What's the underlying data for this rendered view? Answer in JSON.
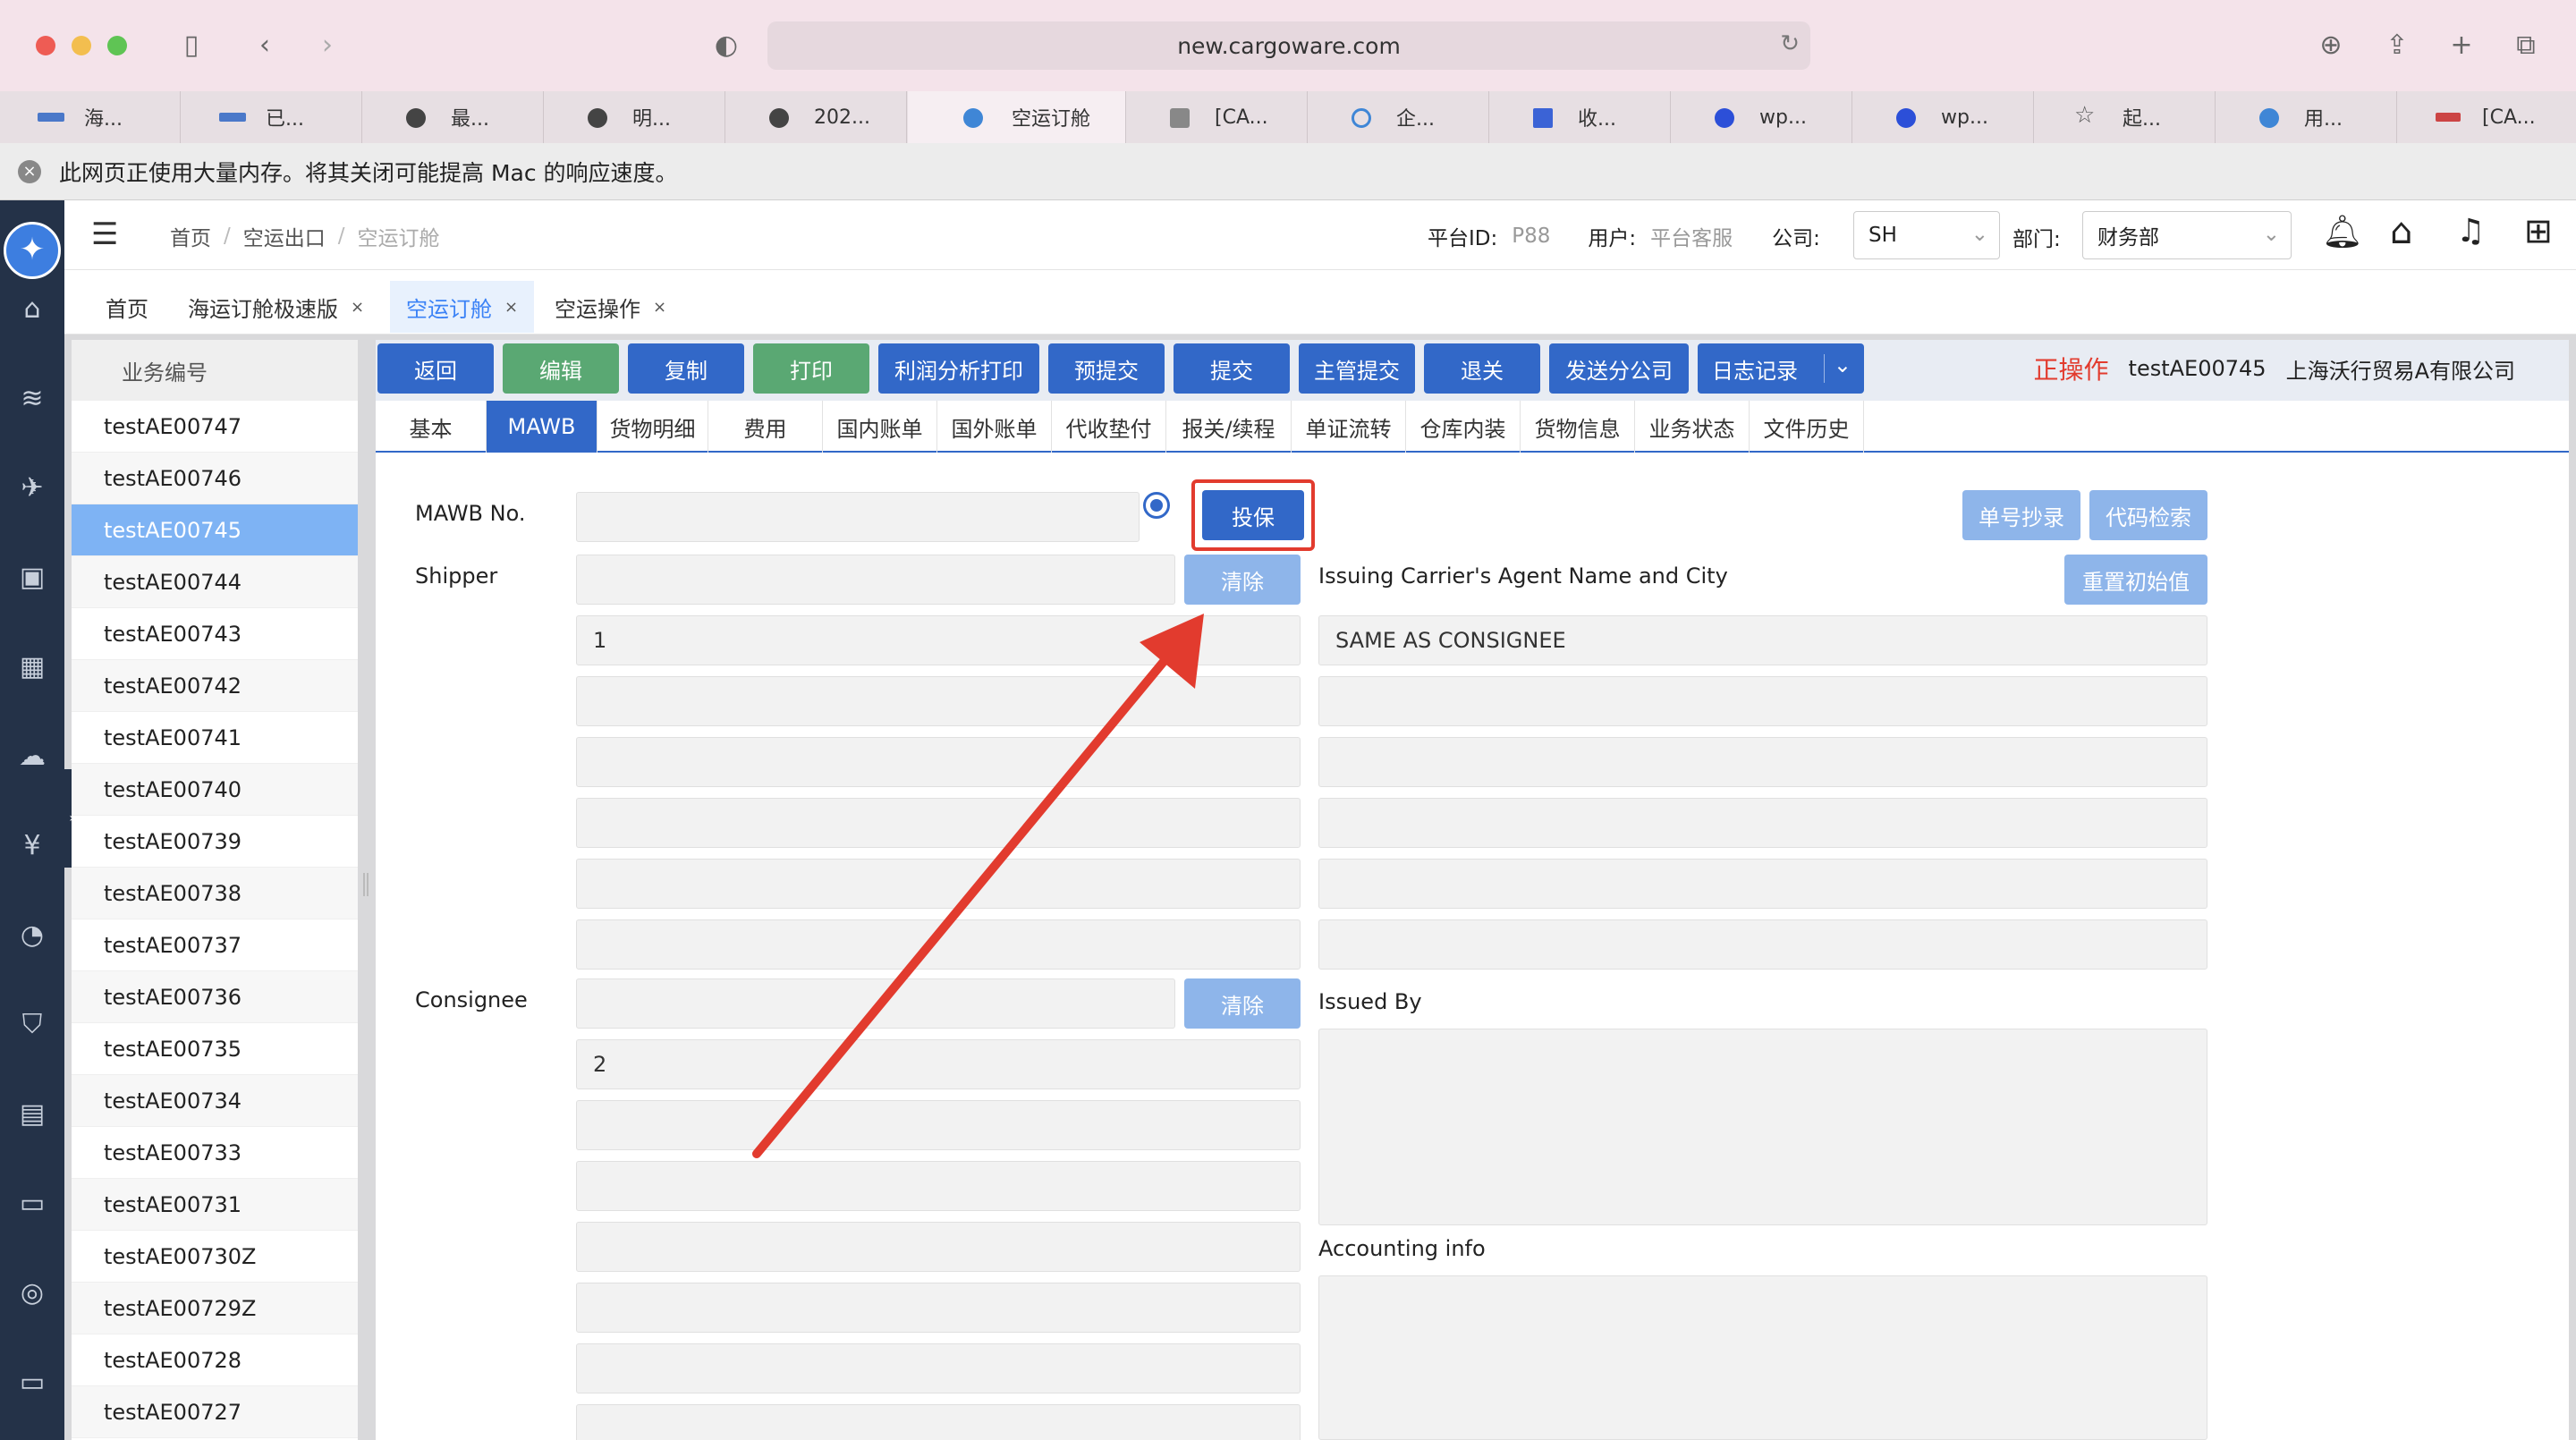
{
  "browser": {
    "url": "new.cargoware.com",
    "tabs": [
      "海...",
      "已...",
      "最...",
      "明...",
      "202...",
      "空运订舱",
      "[CA...",
      "企...",
      "收...",
      "wp...",
      "wp...",
      "起...",
      "用...",
      "[CA..."
    ],
    "active_tab": 5,
    "notice": "此网页正使用大量内存。将其关闭可能提高 Mac 的响应速度。"
  },
  "header": {
    "breadcrumb": [
      "首页",
      "空运出口",
      "空运订舱"
    ],
    "platform_label": "平台ID:",
    "platform_value": "P88",
    "user_label": "用户:",
    "user_value": "平台客服",
    "company_label": "公司:",
    "company_value": "SH",
    "dept_label": "部门:",
    "dept_value": "财务部"
  },
  "page_tabs": [
    "首页",
    "海运订舱极速版",
    "空运订舱",
    "空运操作"
  ],
  "list": {
    "header": "业务编号",
    "items": [
      "testAE00747",
      "testAE00746",
      "testAE00745",
      "testAE00744",
      "testAE00743",
      "testAE00742",
      "testAE00741",
      "testAE00740",
      "testAE00739",
      "testAE00738",
      "testAE00737",
      "testAE00736",
      "testAE00735",
      "testAE00734",
      "testAE00733",
      "testAE00731",
      "testAE00730Z",
      "testAE00729Z",
      "testAE00728",
      "testAE00727"
    ],
    "selected": "testAE00745"
  },
  "toolbar": {
    "buttons": [
      "返回",
      "编辑",
      "复制",
      "打印",
      "利润分析打印",
      "预提交",
      "提交",
      "主管提交",
      "退关",
      "发送分公司",
      "日志记录"
    ],
    "status": "正操作",
    "job_no": "testAE00745",
    "company": "上海沃行贸易A有限公司"
  },
  "form_tabs": [
    "基本",
    "MAWB",
    "货物明细",
    "费用",
    "国内账单",
    "国外账单",
    "代收垫付",
    "报关/续程",
    "单证流转",
    "仓库内装",
    "货物信息",
    "业务状态",
    "文件历史"
  ],
  "form": {
    "mawb_label": "MAWB No.",
    "insure_button": "投保",
    "copy_button": "单号抄录",
    "code_search_button": "代码检索",
    "shipper_label": "Shipper",
    "clear_button": "清除",
    "agent_label": "Issuing Carrier's Agent Name and City",
    "reset_button": "重置初始值",
    "shipper_line1": "1",
    "agent_line1": "SAME AS CONSIGNEE",
    "consignee_label": "Consignee",
    "consignee_line1": "2",
    "issued_by_label": "Issued By",
    "accounting_label": "Accounting info"
  },
  "colors": {
    "primary": "#3268c8",
    "green": "#5aa873",
    "highlight": "#e23b2e",
    "selected_row": "#7eb3f4"
  }
}
